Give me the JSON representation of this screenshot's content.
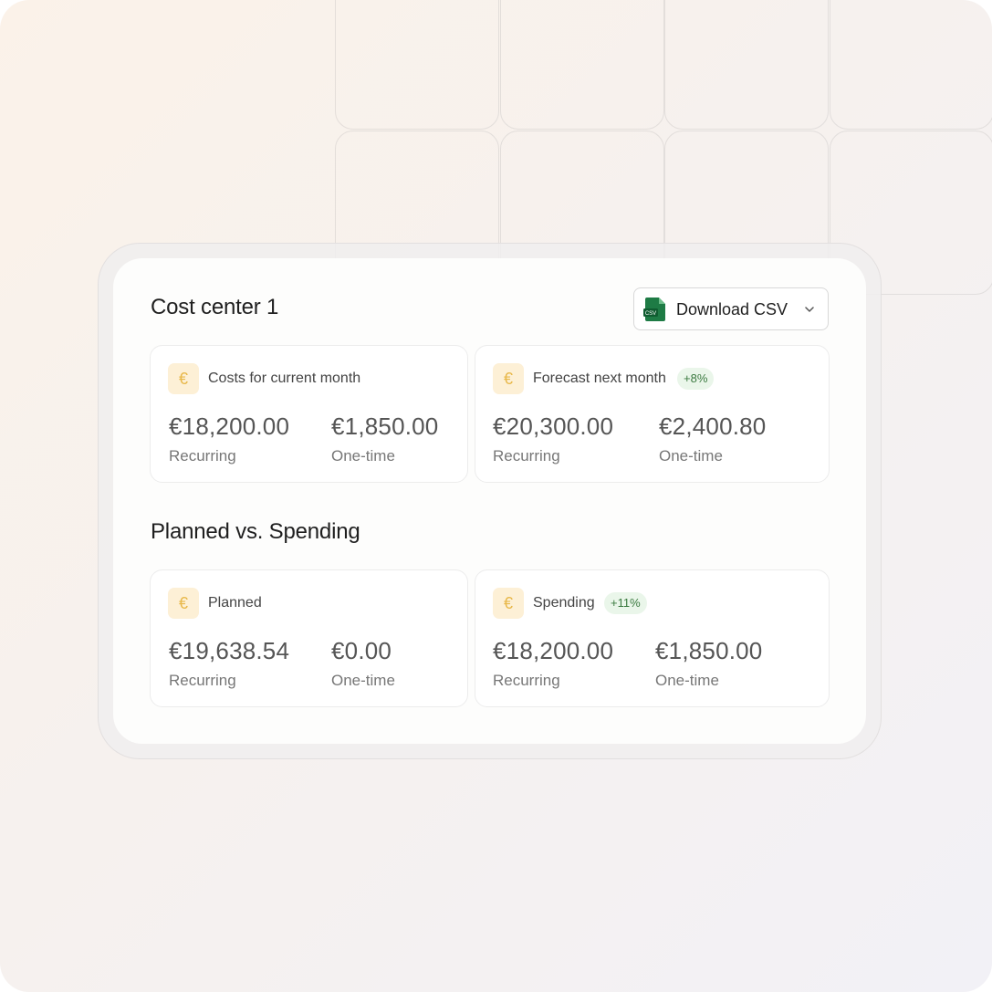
{
  "panel": {
    "title": "Cost center 1",
    "download_button": {
      "label": "Download CSV",
      "icon": "csv-file-icon",
      "chevron": "chevron-down-icon",
      "icon_text": "CSV"
    }
  },
  "cards_top": [
    {
      "label": "Costs for current month",
      "badge": "",
      "recurring": "€18,200.00",
      "recurring_label": "Recurring",
      "onetime": "€1,850.00",
      "onetime_label": "One-time"
    },
    {
      "label": "Forecast next month",
      "badge": "+8%",
      "recurring": "€20,300.00",
      "recurring_label": "Recurring",
      "onetime": "€2,400.80",
      "onetime_label": "One-time"
    }
  ],
  "section": {
    "title": "Planned vs. Spending"
  },
  "cards_bottom": [
    {
      "label": "Planned",
      "badge": "",
      "recurring": "€19,638.54",
      "recurring_label": "Recurring",
      "onetime": "€0.00",
      "onetime_label": "One-time"
    },
    {
      "label": "Spending",
      "badge": "+11%",
      "recurring": "€18,200.00",
      "recurring_label": "Recurring",
      "onetime": "€1,850.00",
      "onetime_label": "One-time"
    }
  ],
  "euro_symbol": "€",
  "colors": {
    "euro_icon_bg": "#fdf0d6",
    "euro_icon_fg": "#e8b84a",
    "badge_bg": "#eaf6ea",
    "badge_fg": "#3b7a40",
    "csv_green": "#1e7b45"
  }
}
